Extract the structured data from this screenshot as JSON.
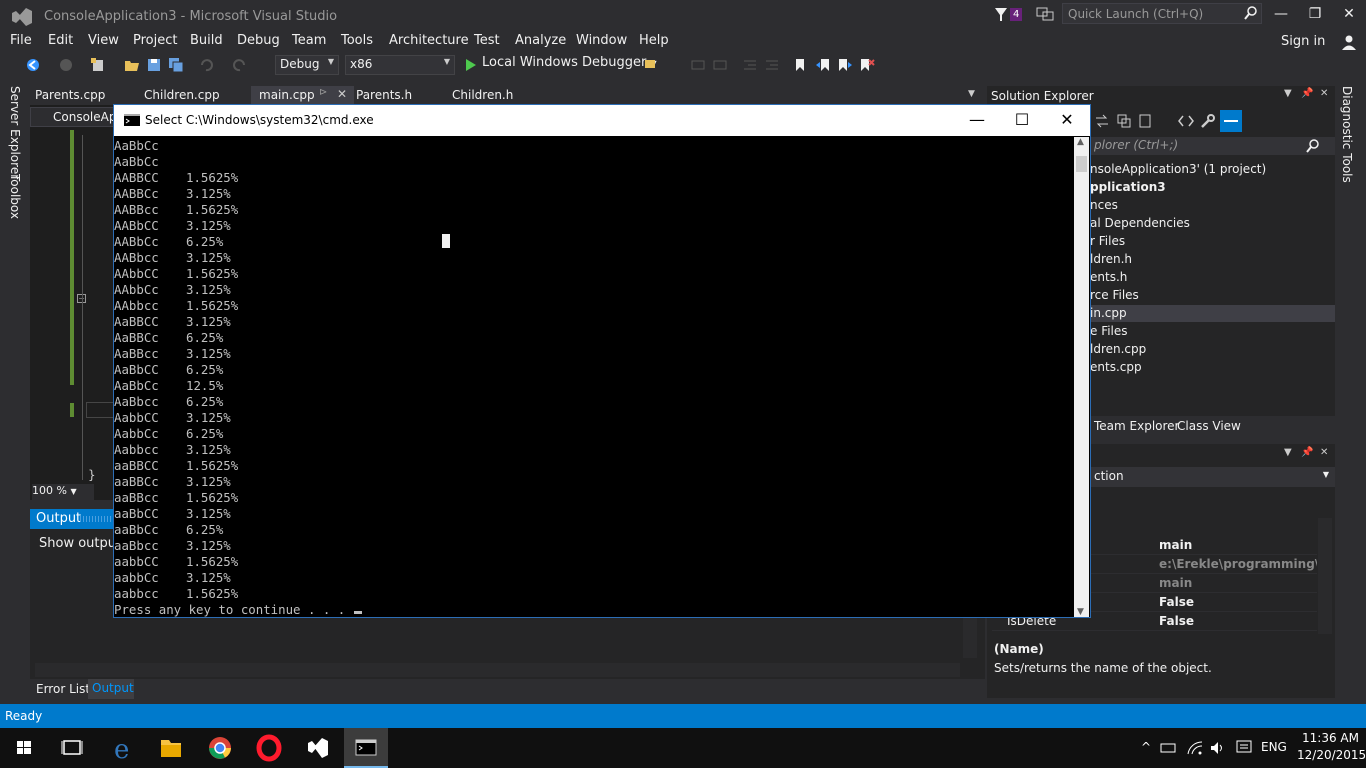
{
  "window": {
    "title": "ConsoleApplication3 - Microsoft Visual Studio",
    "notifications": "4"
  },
  "quick_launch": {
    "placeholder": "Quick Launch (Ctrl+Q)"
  },
  "menu": [
    "File",
    "Edit",
    "View",
    "Project",
    "Build",
    "Debug",
    "Team",
    "Tools",
    "Architecture",
    "Test",
    "Analyze",
    "Window",
    "Help"
  ],
  "signin": "Sign in",
  "toolbar": {
    "config": "Debug",
    "platform": "x86",
    "debugger": "Local Windows Debugger"
  },
  "side_tabs": {
    "server_explorer": "Server Explorer",
    "toolbox": "Toolbox",
    "diagnostic_tools": "Diagnostic Tools"
  },
  "doc_tabs": [
    "Parents.cpp",
    "Children.cpp",
    "main.cpp",
    "Parents.h",
    "Children.h"
  ],
  "editor": {
    "nav": "ConsoleApp",
    "brace": "}",
    "zoom": "100 %"
  },
  "output": {
    "title": "Output",
    "show_output": "Show output f"
  },
  "bottom_tabs": {
    "error_list": "Error List",
    "output": "Output"
  },
  "solution_explorer": {
    "title": "Solution Explorer",
    "search_placeholder": "plorer (Ctrl+;)",
    "items": [
      "nsoleApplication3' (1 project)",
      "pplication3",
      "nces",
      "al Dependencies",
      "r Files",
      "ldren.h",
      "ents.h",
      "rce Files",
      "in.cpp",
      "e Files",
      "ldren.cpp",
      "ents.cpp"
    ],
    "tab_team": "Team Explorer",
    "tab_class": "Class View"
  },
  "properties": {
    "combo": "ction",
    "rows": [
      {
        "name": "",
        "value": "main",
        "muted": false
      },
      {
        "name": "",
        "value": "e:\\Erekle\\programming\\mzi",
        "muted": true
      },
      {
        "name": "",
        "value": "main",
        "muted": true
      },
      {
        "name": "",
        "value": "False",
        "muted": false
      },
      {
        "name": "IsDelete",
        "value": "False",
        "muted": false
      }
    ],
    "desc_name": "(Name)",
    "desc_text": "Sets/returns the name of the object."
  },
  "status": "Ready",
  "taskbar": {
    "language": "ENG",
    "time": "11:36 AM",
    "date": "12/20/2015"
  },
  "cmd": {
    "title": "Select C:\\Windows\\system32\\cmd.exe",
    "lines": [
      [
        "AaBbCc",
        ""
      ],
      [
        "AaBbCc",
        ""
      ],
      [
        "AABBCC",
        "1.5625%"
      ],
      [
        "AABBCc",
        "3.125%"
      ],
      [
        "AABBcc",
        "1.5625%"
      ],
      [
        "AABbCC",
        "3.125%"
      ],
      [
        "AABbCc",
        "6.25%"
      ],
      [
        "AABbcc",
        "3.125%"
      ],
      [
        "AAbbCC",
        "1.5625%"
      ],
      [
        "AAbbCc",
        "3.125%"
      ],
      [
        "AAbbcc",
        "1.5625%"
      ],
      [
        "AaBBCC",
        "3.125%"
      ],
      [
        "AaBBCc",
        "6.25%"
      ],
      [
        "AaBBcc",
        "3.125%"
      ],
      [
        "AaBbCC",
        "6.25%"
      ],
      [
        "AaBbCc",
        "12.5%"
      ],
      [
        "AaBbcc",
        "6.25%"
      ],
      [
        "AabbCC",
        "3.125%"
      ],
      [
        "AabbCc",
        "6.25%"
      ],
      [
        "Aabbcc",
        "3.125%"
      ],
      [
        "aaBBCC",
        "1.5625%"
      ],
      [
        "aaBBCc",
        "3.125%"
      ],
      [
        "aaBBcc",
        "1.5625%"
      ],
      [
        "aaBbCC",
        "3.125%"
      ],
      [
        "aaBbCc",
        "6.25%"
      ],
      [
        "aaBbcc",
        "3.125%"
      ],
      [
        "aabbCC",
        "1.5625%"
      ],
      [
        "aabbCc",
        "3.125%"
      ],
      [
        "aabbcc",
        "1.5625%"
      ]
    ],
    "prompt": "Press any key to continue . . ."
  }
}
